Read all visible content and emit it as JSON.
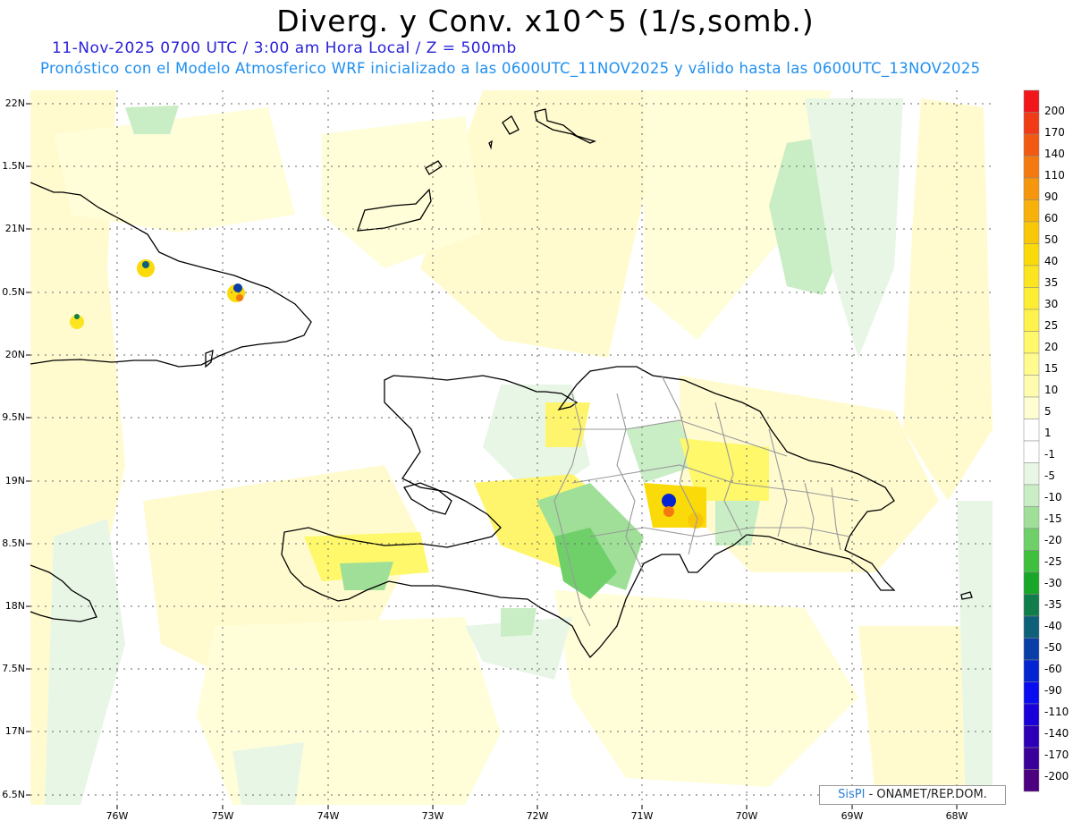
{
  "title": "Diverg. y Conv. x10^5 (1/s,somb.)",
  "subtitle_date": "11-Nov-2025  0700 UTC / 3:00 am Hora Local / Z = 500mb",
  "subtitle_model": "Pronóstico con el Modelo Atmosferico WRF inicializado a las 0600UTC_11NOV2025 y válido hasta las  0600UTC_13NOV2025",
  "credit": {
    "brand": "SisPI",
    "text": "- ONAMET/REP.DOM."
  },
  "lon_labels": [
    "76W",
    "75W",
    "74W",
    "73W",
    "72W",
    "71W",
    "70W",
    "69W",
    "68W"
  ],
  "lat_labels": [
    "22N",
    "1.5N",
    "21N",
    "0.5N",
    "20N",
    "9.5N",
    "19N",
    "8.5N",
    "18N",
    "7.5N",
    "17N",
    "6.5N"
  ],
  "colorbar": {
    "labels": [
      "200",
      "170",
      "140",
      "110",
      "90",
      "60",
      "50",
      "40",
      "35",
      "30",
      "25",
      "20",
      "15",
      "10",
      "5",
      "1",
      "-1",
      "-5",
      "-10",
      "-15",
      "-20",
      "-25",
      "-30",
      "-35",
      "-40",
      "-50",
      "-60",
      "-90",
      "-110",
      "-140",
      "-170",
      "-200"
    ],
    "colors": [
      "#f0161a",
      "#f13b16",
      "#f25a14",
      "#f47a10",
      "#f5960c",
      "#f7b10a",
      "#f8c808",
      "#fbda0a",
      "#fce420",
      "#fdee33",
      "#fff24a",
      "#fff86b",
      "#fffb8e",
      "#fffcb0",
      "#fffed3",
      "#ffffff",
      "#ffffff",
      "#e8f6e6",
      "#c9edc4",
      "#9fdf98",
      "#6fd069",
      "#3fc03d",
      "#19a72a",
      "#107d4a",
      "#0e5f78",
      "#0a3ea7",
      "#0524d1",
      "#0a0cf0",
      "#1a00d8",
      "#2d00b8",
      "#3a009a",
      "#4c0080"
    ]
  }
}
